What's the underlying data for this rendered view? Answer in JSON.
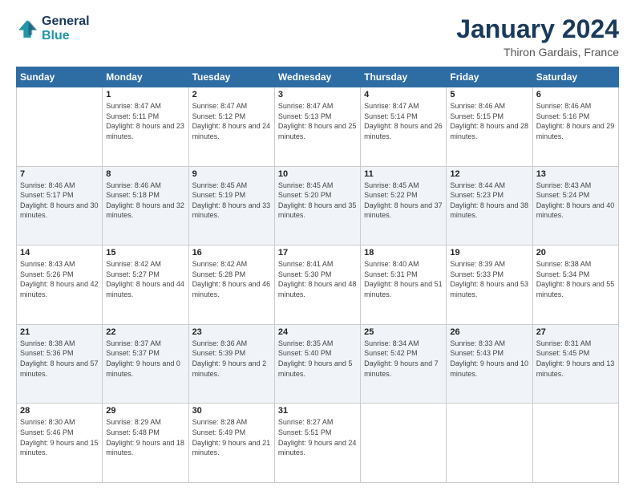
{
  "header": {
    "logo_line1": "General",
    "logo_line2": "Blue",
    "title": "January 2024",
    "subtitle": "Thiron Gardais, France"
  },
  "weekdays": [
    "Sunday",
    "Monday",
    "Tuesday",
    "Wednesday",
    "Thursday",
    "Friday",
    "Saturday"
  ],
  "weeks": [
    [
      {
        "day": "",
        "content": ""
      },
      {
        "day": "1",
        "content": "Sunrise: 8:47 AM\nSunset: 5:11 PM\nDaylight: 8 hours\nand 23 minutes."
      },
      {
        "day": "2",
        "content": "Sunrise: 8:47 AM\nSunset: 5:12 PM\nDaylight: 8 hours\nand 24 minutes."
      },
      {
        "day": "3",
        "content": "Sunrise: 8:47 AM\nSunset: 5:13 PM\nDaylight: 8 hours\nand 25 minutes."
      },
      {
        "day": "4",
        "content": "Sunrise: 8:47 AM\nSunset: 5:14 PM\nDaylight: 8 hours\nand 26 minutes."
      },
      {
        "day": "5",
        "content": "Sunrise: 8:46 AM\nSunset: 5:15 PM\nDaylight: 8 hours\nand 28 minutes."
      },
      {
        "day": "6",
        "content": "Sunrise: 8:46 AM\nSunset: 5:16 PM\nDaylight: 8 hours\nand 29 minutes."
      }
    ],
    [
      {
        "day": "7",
        "content": "Sunrise: 8:46 AM\nSunset: 5:17 PM\nDaylight: 8 hours\nand 30 minutes."
      },
      {
        "day": "8",
        "content": "Sunrise: 8:46 AM\nSunset: 5:18 PM\nDaylight: 8 hours\nand 32 minutes."
      },
      {
        "day": "9",
        "content": "Sunrise: 8:45 AM\nSunset: 5:19 PM\nDaylight: 8 hours\nand 33 minutes."
      },
      {
        "day": "10",
        "content": "Sunrise: 8:45 AM\nSunset: 5:20 PM\nDaylight: 8 hours\nand 35 minutes."
      },
      {
        "day": "11",
        "content": "Sunrise: 8:45 AM\nSunset: 5:22 PM\nDaylight: 8 hours\nand 37 minutes."
      },
      {
        "day": "12",
        "content": "Sunrise: 8:44 AM\nSunset: 5:23 PM\nDaylight: 8 hours\nand 38 minutes."
      },
      {
        "day": "13",
        "content": "Sunrise: 8:43 AM\nSunset: 5:24 PM\nDaylight: 8 hours\nand 40 minutes."
      }
    ],
    [
      {
        "day": "14",
        "content": "Sunrise: 8:43 AM\nSunset: 5:26 PM\nDaylight: 8 hours\nand 42 minutes."
      },
      {
        "day": "15",
        "content": "Sunrise: 8:42 AM\nSunset: 5:27 PM\nDaylight: 8 hours\nand 44 minutes."
      },
      {
        "day": "16",
        "content": "Sunrise: 8:42 AM\nSunset: 5:28 PM\nDaylight: 8 hours\nand 46 minutes."
      },
      {
        "day": "17",
        "content": "Sunrise: 8:41 AM\nSunset: 5:30 PM\nDaylight: 8 hours\nand 48 minutes."
      },
      {
        "day": "18",
        "content": "Sunrise: 8:40 AM\nSunset: 5:31 PM\nDaylight: 8 hours\nand 51 minutes."
      },
      {
        "day": "19",
        "content": "Sunrise: 8:39 AM\nSunset: 5:33 PM\nDaylight: 8 hours\nand 53 minutes."
      },
      {
        "day": "20",
        "content": "Sunrise: 8:38 AM\nSunset: 5:34 PM\nDaylight: 8 hours\nand 55 minutes."
      }
    ],
    [
      {
        "day": "21",
        "content": "Sunrise: 8:38 AM\nSunset: 5:36 PM\nDaylight: 8 hours\nand 57 minutes."
      },
      {
        "day": "22",
        "content": "Sunrise: 8:37 AM\nSunset: 5:37 PM\nDaylight: 9 hours\nand 0 minutes."
      },
      {
        "day": "23",
        "content": "Sunrise: 8:36 AM\nSunset: 5:39 PM\nDaylight: 9 hours\nand 2 minutes."
      },
      {
        "day": "24",
        "content": "Sunrise: 8:35 AM\nSunset: 5:40 PM\nDaylight: 9 hours\nand 5 minutes."
      },
      {
        "day": "25",
        "content": "Sunrise: 8:34 AM\nSunset: 5:42 PM\nDaylight: 9 hours\nand 7 minutes."
      },
      {
        "day": "26",
        "content": "Sunrise: 8:33 AM\nSunset: 5:43 PM\nDaylight: 9 hours\nand 10 minutes."
      },
      {
        "day": "27",
        "content": "Sunrise: 8:31 AM\nSunset: 5:45 PM\nDaylight: 9 hours\nand 13 minutes."
      }
    ],
    [
      {
        "day": "28",
        "content": "Sunrise: 8:30 AM\nSunset: 5:46 PM\nDaylight: 9 hours\nand 15 minutes."
      },
      {
        "day": "29",
        "content": "Sunrise: 8:29 AM\nSunset: 5:48 PM\nDaylight: 9 hours\nand 18 minutes."
      },
      {
        "day": "30",
        "content": "Sunrise: 8:28 AM\nSunset: 5:49 PM\nDaylight: 9 hours\nand 21 minutes."
      },
      {
        "day": "31",
        "content": "Sunrise: 8:27 AM\nSunset: 5:51 PM\nDaylight: 9 hours\nand 24 minutes."
      },
      {
        "day": "",
        "content": ""
      },
      {
        "day": "",
        "content": ""
      },
      {
        "day": "",
        "content": ""
      }
    ]
  ]
}
